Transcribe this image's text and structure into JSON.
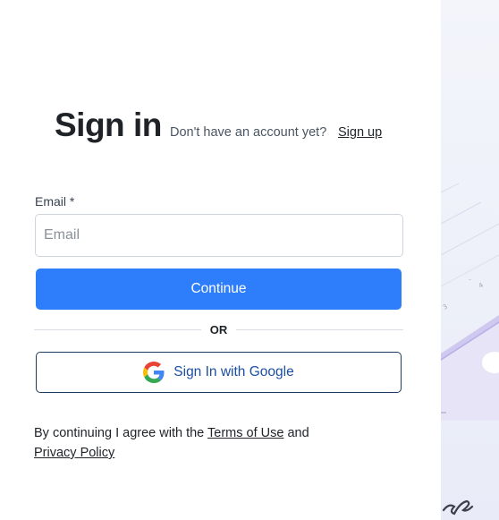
{
  "header": {
    "title": "Sign in",
    "no_account_text": "Don't have an account yet?",
    "signup_link": "Sign up"
  },
  "form": {
    "email_label": "Email *",
    "email_placeholder": "Email",
    "email_value": "",
    "continue_label": "Continue",
    "divider_text": "OR",
    "google_label": "Sign In with Google"
  },
  "legal": {
    "prefix": "By continuing I agree with the",
    "terms_link": "Terms of Use",
    "conjunction": "and",
    "privacy_link": "Privacy Policy"
  },
  "icons": {
    "google": "google-logo-icon"
  },
  "colors": {
    "primary": "#2e7dfb",
    "google_text": "#1b4fa3",
    "title": "#1f2328"
  }
}
